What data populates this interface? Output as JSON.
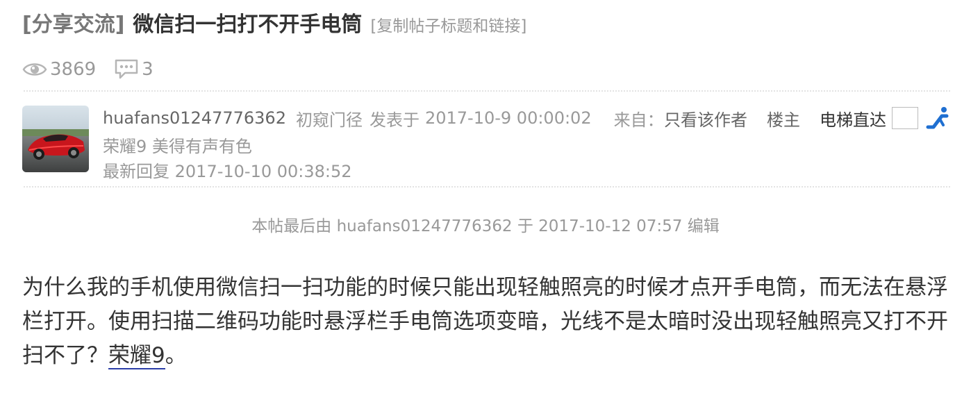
{
  "thread": {
    "category": "[分享交流]",
    "title": "微信扫一扫打不开手电筒",
    "copy_link": "[复制帖子标题和链接]",
    "views": "3869",
    "replies": "3"
  },
  "post": {
    "username": "huafans01247776362",
    "user_group": "初窥门径",
    "posted_prefix": "发表于",
    "posted_time": "2017-10-9 00:00:02",
    "from_label": "来自：",
    "device_signature": "荣耀9 美得有声有色",
    "last_reply_label": "最新回复",
    "last_reply_time": "2017-10-10 00:38:52",
    "edit_note": "本帖最后由 huafans01247776362 于 2017-10-12 07:57 编辑",
    "content_text": "为什么我的手机使用微信扫一扫功能的时候只能出现轻触照亮的时候才点开手电筒，而无法在悬浮栏打开。使用扫描二维码功能时悬浮栏手电筒选项变暗，光线不是太暗时没出现轻触照亮又打不开扫不了？",
    "content_link": "荣耀9",
    "content_tail": "。"
  },
  "tools": {
    "only_author": "只看该作者",
    "floor_label": "楼主",
    "jump_label": "电梯直达"
  },
  "icons": {
    "views": "eye-icon",
    "replies": "comment-icon",
    "jump": "elevator-go-icon"
  },
  "colors": {
    "link_underline": "#2b3ea8",
    "jump_icon": "#1f6fd1"
  }
}
